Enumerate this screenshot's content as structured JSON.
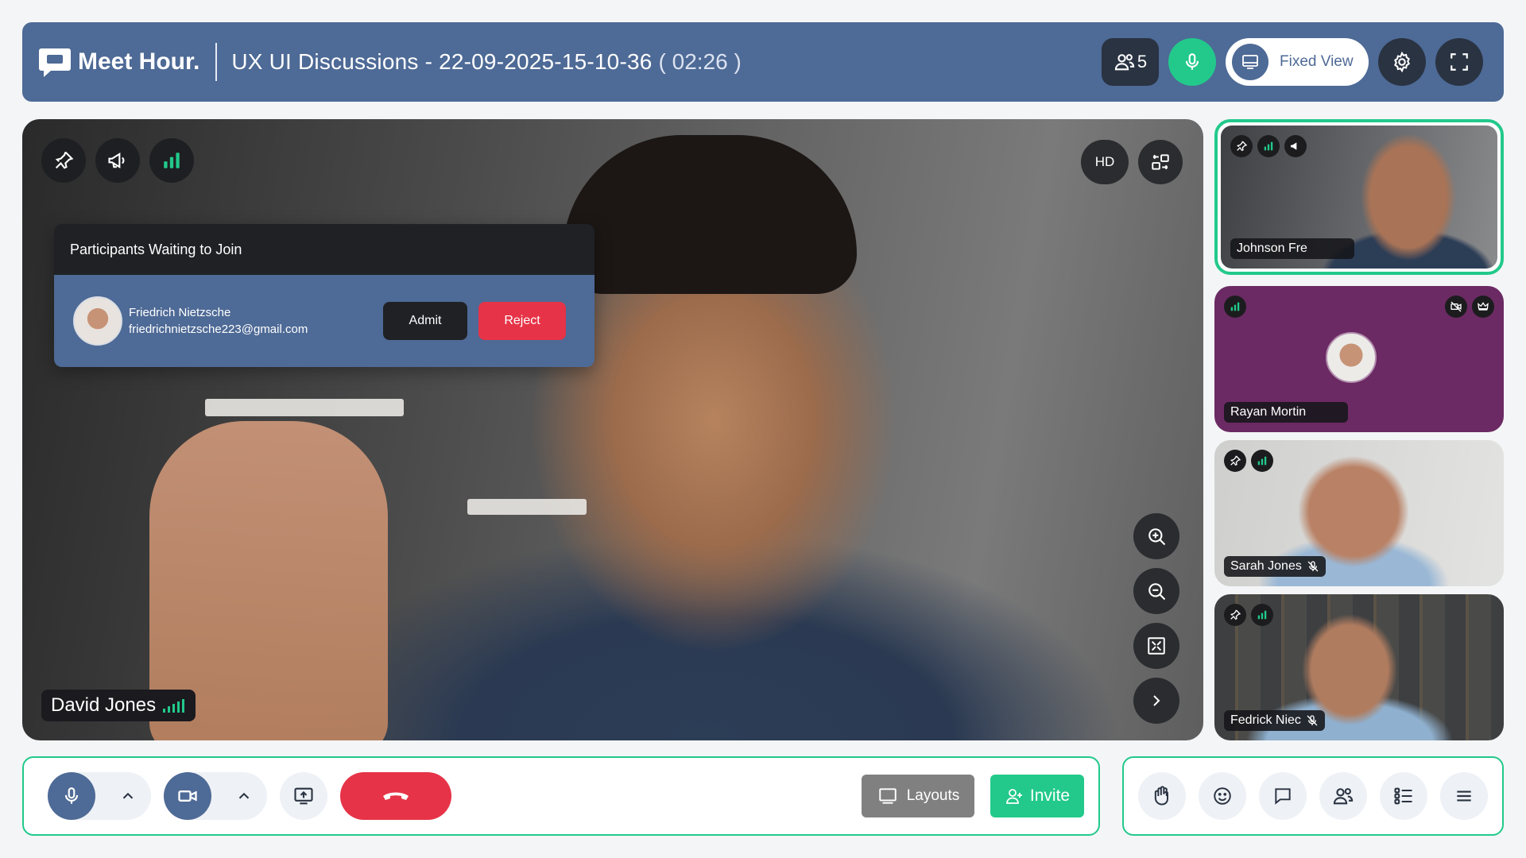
{
  "brand": {
    "name": "Meet Hour."
  },
  "meeting": {
    "title": "UX UI Discussions - 22-09-2025-15-10-36",
    "timer": "( 02:26 )"
  },
  "header": {
    "participant_count": "5",
    "view_label": "Fixed View"
  },
  "main_video": {
    "participant_name": "David Jones",
    "quality_label": "HD"
  },
  "waiting_panel": {
    "title": "Participants Waiting to Join",
    "participant": {
      "name": "Friedrich Nietzsche",
      "email": "friedrichnietzsche223@gmail.com"
    },
    "admit_label": "Admit",
    "reject_label": "Reject"
  },
  "tiles": [
    {
      "name": "Johnson Fre",
      "active_speaker": true
    },
    {
      "name": "Rayan Mortin",
      "video_off": true
    },
    {
      "name": "Sarah Jones",
      "muted": true
    },
    {
      "name": "Fedrick Niec",
      "muted": true
    }
  ],
  "toolbar": {
    "layouts_label": "Layouts",
    "invite_label": "Invite"
  },
  "colors": {
    "brand_blue": "#4e6a96",
    "accent_green": "#22c98b",
    "danger_red": "#e63347",
    "dark": "#1f2125"
  },
  "icons": {
    "header": [
      "participants-icon",
      "microphone-icon",
      "monitor-icon",
      "settings-gear-icon",
      "fullscreen-icon"
    ],
    "main_overlay": [
      "pin-icon",
      "megaphone-icon",
      "signal-bars-icon",
      "switch-camera-icon",
      "zoom-in-icon",
      "zoom-out-icon",
      "fit-screen-icon",
      "chevron-right-icon"
    ],
    "bottom_tools": [
      "raise-hand-icon",
      "emoji-icon",
      "chat-icon",
      "participants-icon",
      "polls-list-icon",
      "menu-icon"
    ]
  }
}
